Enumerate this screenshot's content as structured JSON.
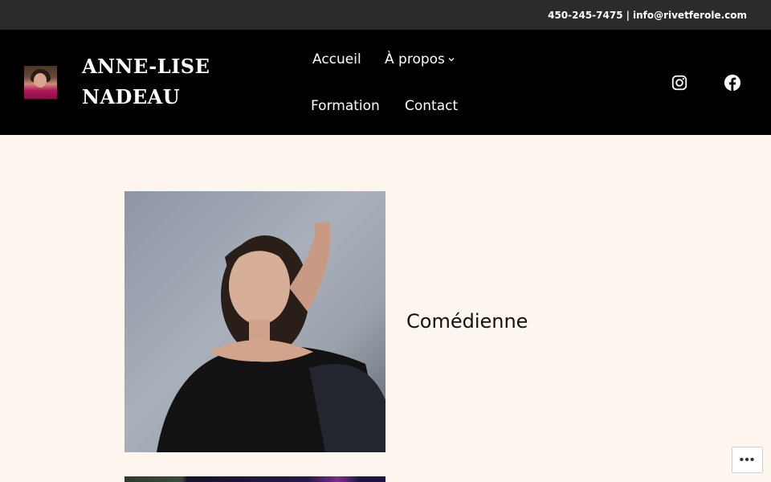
{
  "topbar": {
    "phone": "450-245-7475",
    "separator": "|",
    "email": "info@rivetferole.com"
  },
  "header": {
    "site_title_line1": "ANNE-LISE",
    "site_title_line2": "NADEAU",
    "logo_icon": "avatar-photo",
    "nav": {
      "accueil": "Accueil",
      "apropos": "À propos",
      "formation": "Formation",
      "contact": "Contact"
    },
    "social": [
      "instagram-icon",
      "facebook-icon"
    ]
  },
  "main": {
    "caption": "Comédienne"
  },
  "colors": {
    "page_background": "#fdf6ee",
    "header_background": "#000000",
    "topbar_background": "#2b2b2b"
  },
  "more_button_icon": "ellipsis-icon"
}
